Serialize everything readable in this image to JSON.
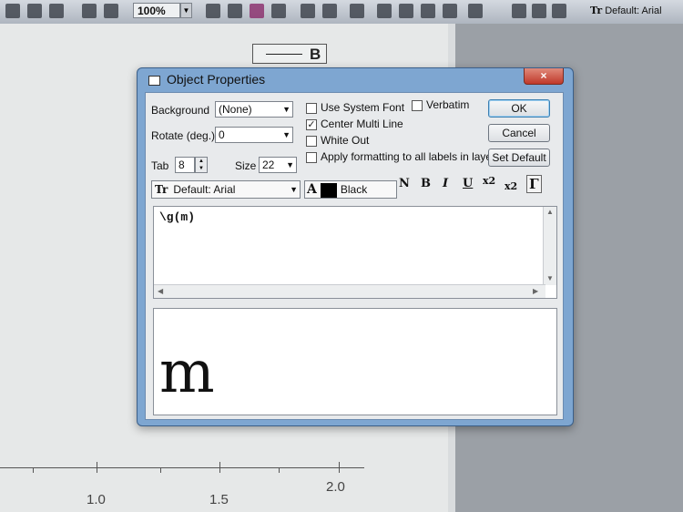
{
  "toolbar": {
    "zoom": "100%",
    "font_label": "Default: Arial",
    "font_icon": "Tr"
  },
  "graph": {
    "legend_label": "B",
    "xticks": [
      "1.0",
      "1.5",
      "2.0"
    ]
  },
  "dialog": {
    "title": "Object Properties",
    "close_label": "×",
    "background_label": "Background",
    "background_value": "(None)",
    "rotate_label": "Rotate (deg.)",
    "rotate_value": "0",
    "tab_label": "Tab",
    "tab_value": "8",
    "size_label": "Size",
    "size_value": "22",
    "use_system_font": "Use System Font",
    "verbatim": "Verbatim",
    "center_multi_line": "Center Multi Line",
    "white_out": "White Out",
    "apply_formatting": "Apply formatting to all labels in layer",
    "checked": {
      "use_system_font": false,
      "verbatim": false,
      "center_multi_line": true,
      "white_out": false,
      "apply_formatting": false
    },
    "ok_label": "OK",
    "cancel_label": "Cancel",
    "set_default_label": "Set Default",
    "font_value": "Default: Arial",
    "font_icon": "Tr",
    "color_prefix": "A",
    "color_value": "Black",
    "color_hex": "#000000",
    "format_buttons": [
      "N",
      "B",
      "I",
      "U",
      "x2",
      "x2",
      "Γ"
    ],
    "editor_text": "\\g(m)",
    "preview_text": "m"
  }
}
